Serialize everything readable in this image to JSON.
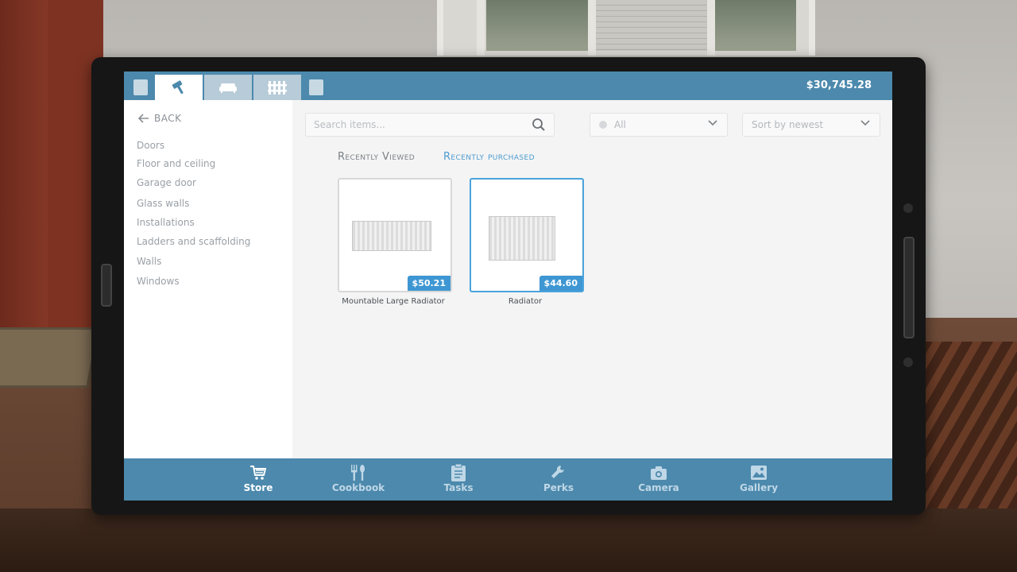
{
  "balance": "$30,745.28",
  "top_tabs": [
    {
      "name": "build",
      "icon": "hammer-icon",
      "active": true
    },
    {
      "name": "furniture",
      "icon": "sofa-icon",
      "active": false
    },
    {
      "name": "fence",
      "icon": "fence-icon",
      "active": false
    }
  ],
  "sidebar": {
    "back_label": "BACK",
    "categories": [
      "Doors",
      "Floor and ceiling",
      "Garage door",
      "Glass walls",
      "Installations",
      "Ladders and scaffolding",
      "Walls",
      "Windows"
    ]
  },
  "search": {
    "placeholder": "Search items..."
  },
  "filter": {
    "value": "All"
  },
  "sort": {
    "value": "Sort by newest"
  },
  "sections": {
    "recently_viewed": "Recently Viewed",
    "recently_purchased": "Recently purchased",
    "active": "recently_purchased"
  },
  "items": [
    {
      "name": "Mountable Large Radiator",
      "price": "$50.21",
      "selected": false
    },
    {
      "name": "Radiator",
      "price": "$44.60",
      "selected": true
    }
  ],
  "bottom_nav": [
    {
      "label": "Store",
      "icon": "cart-icon",
      "active": true
    },
    {
      "label": "Cookbook",
      "icon": "cutlery-icon",
      "active": false
    },
    {
      "label": "Tasks",
      "icon": "clipboard-icon",
      "active": false
    },
    {
      "label": "Perks",
      "icon": "wrench-icon",
      "active": false
    },
    {
      "label": "Camera",
      "icon": "camera-icon",
      "active": false
    },
    {
      "label": "Gallery",
      "icon": "image-icon",
      "active": false
    }
  ],
  "colors": {
    "accent": "#4c89ad",
    "price_badge": "#3e97d3",
    "selected_border": "#49a3dc"
  }
}
